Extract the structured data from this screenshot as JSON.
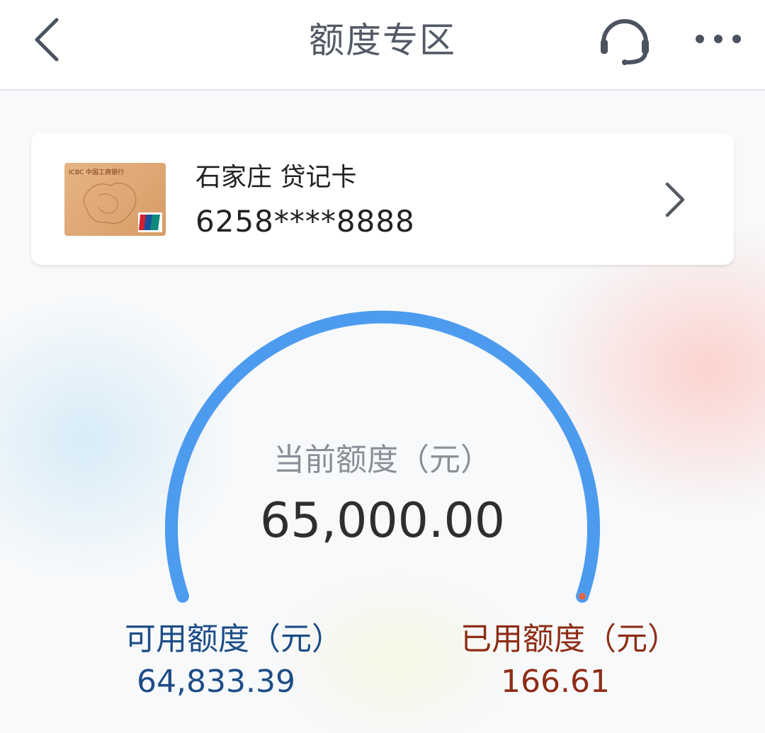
{
  "header": {
    "title": "额度专区",
    "back_icon": "chevron-left-icon",
    "service_icon": "headset-icon",
    "more_icon": "more-dots-icon"
  },
  "card": {
    "name": "石家庄 贷记卡",
    "number": "6258****8888",
    "bank_label": "ICBC 中国工商银行",
    "card_color": "#dca36f"
  },
  "limit": {
    "current_label": "当前额度（元）",
    "current_value": "65,000.00",
    "available_label": "可用额度（元）",
    "available_value": "64,833.39",
    "used_label": "已用额度（元）",
    "used_value": "166.61",
    "used_fraction": 0.0026
  },
  "colors": {
    "gauge": "#4d9bef",
    "available": "#1d4d86",
    "used": "#8e2d16"
  }
}
